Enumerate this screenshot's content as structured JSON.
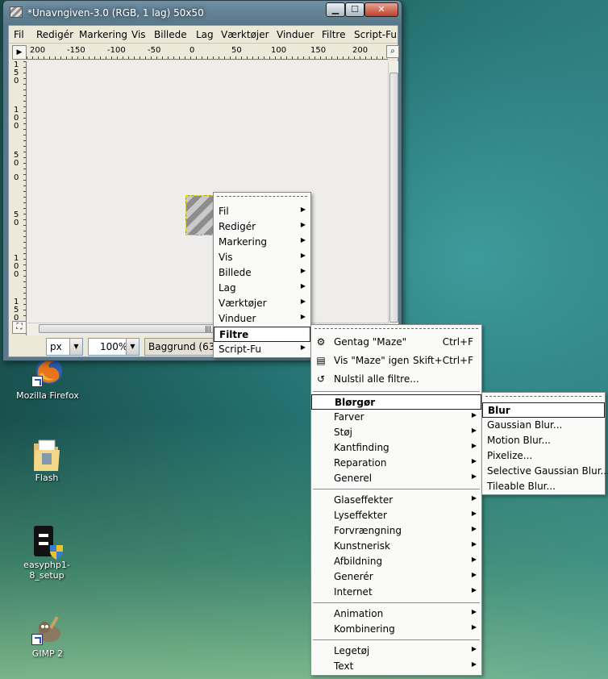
{
  "window": {
    "title": "*Unavngiven-3.0 (RGB, 1 lag) 50x50",
    "minimize": "▁",
    "maximize": "☐",
    "close": "✕"
  },
  "menubar": [
    "Fil",
    "Redigér",
    "Markering",
    "Vis",
    "Billede",
    "Lag",
    "Værktøjer",
    "Vinduer",
    "Filtre",
    "Script-Fu"
  ],
  "ruler_h": [
    "200",
    "-150",
    "-100",
    "-50",
    "0",
    "50",
    "100",
    "150",
    "200"
  ],
  "ruler_v": [
    "1 5 0",
    "1 0 0",
    "5 0",
    "0",
    "5 0",
    "1 0 0",
    "1 5 0"
  ],
  "statusbar": {
    "unit": "px",
    "zoom": "100%",
    "layer_info": "Baggrund (63,5 k"
  },
  "context_menu": {
    "items": [
      "Fil",
      "Redigér",
      "Markering",
      "Vis",
      "Billede",
      "Lag",
      "Værktøjer",
      "Vinduer",
      "Filtre",
      "Script-Fu"
    ],
    "selected": "Filtre"
  },
  "filters_menu": {
    "repeat": {
      "label": "Gentag \"Maze\"",
      "shortcut": "Ctrl+F"
    },
    "reshow": {
      "label": "Vis \"Maze\" igen",
      "shortcut": "Skift+Ctrl+F"
    },
    "reset": {
      "label": "Nulstil alle filtre..."
    },
    "group1": [
      "Blørgør",
      "Farver",
      "Støj",
      "Kantfinding",
      "Reparation",
      "Generel"
    ],
    "group2": [
      "Glaseffekter",
      "Lyseffekter",
      "Forvrængning",
      "Kunstnerisk",
      "Afbildning",
      "Generér",
      "Internet"
    ],
    "group3": [
      "Animation",
      "Kombinering"
    ],
    "group4": [
      "Legetøj",
      "Text"
    ],
    "selected": "Blørgør"
  },
  "blur_menu": {
    "items": [
      "Blur",
      "Gaussian Blur...",
      "Motion Blur...",
      "Pixelize...",
      "Selective Gaussian Blur...",
      "Tileable Blur..."
    ],
    "selected": "Blur"
  },
  "desktop_icons": [
    {
      "label": "Mozilla Firefox",
      "icon": "firefox-icon"
    },
    {
      "label": "Flash",
      "icon": "folder-icon"
    },
    {
      "label": "easyphp1-8_setup",
      "icon": "installer-icon"
    },
    {
      "label": "GIMP 2",
      "icon": "gimp-icon"
    }
  ]
}
